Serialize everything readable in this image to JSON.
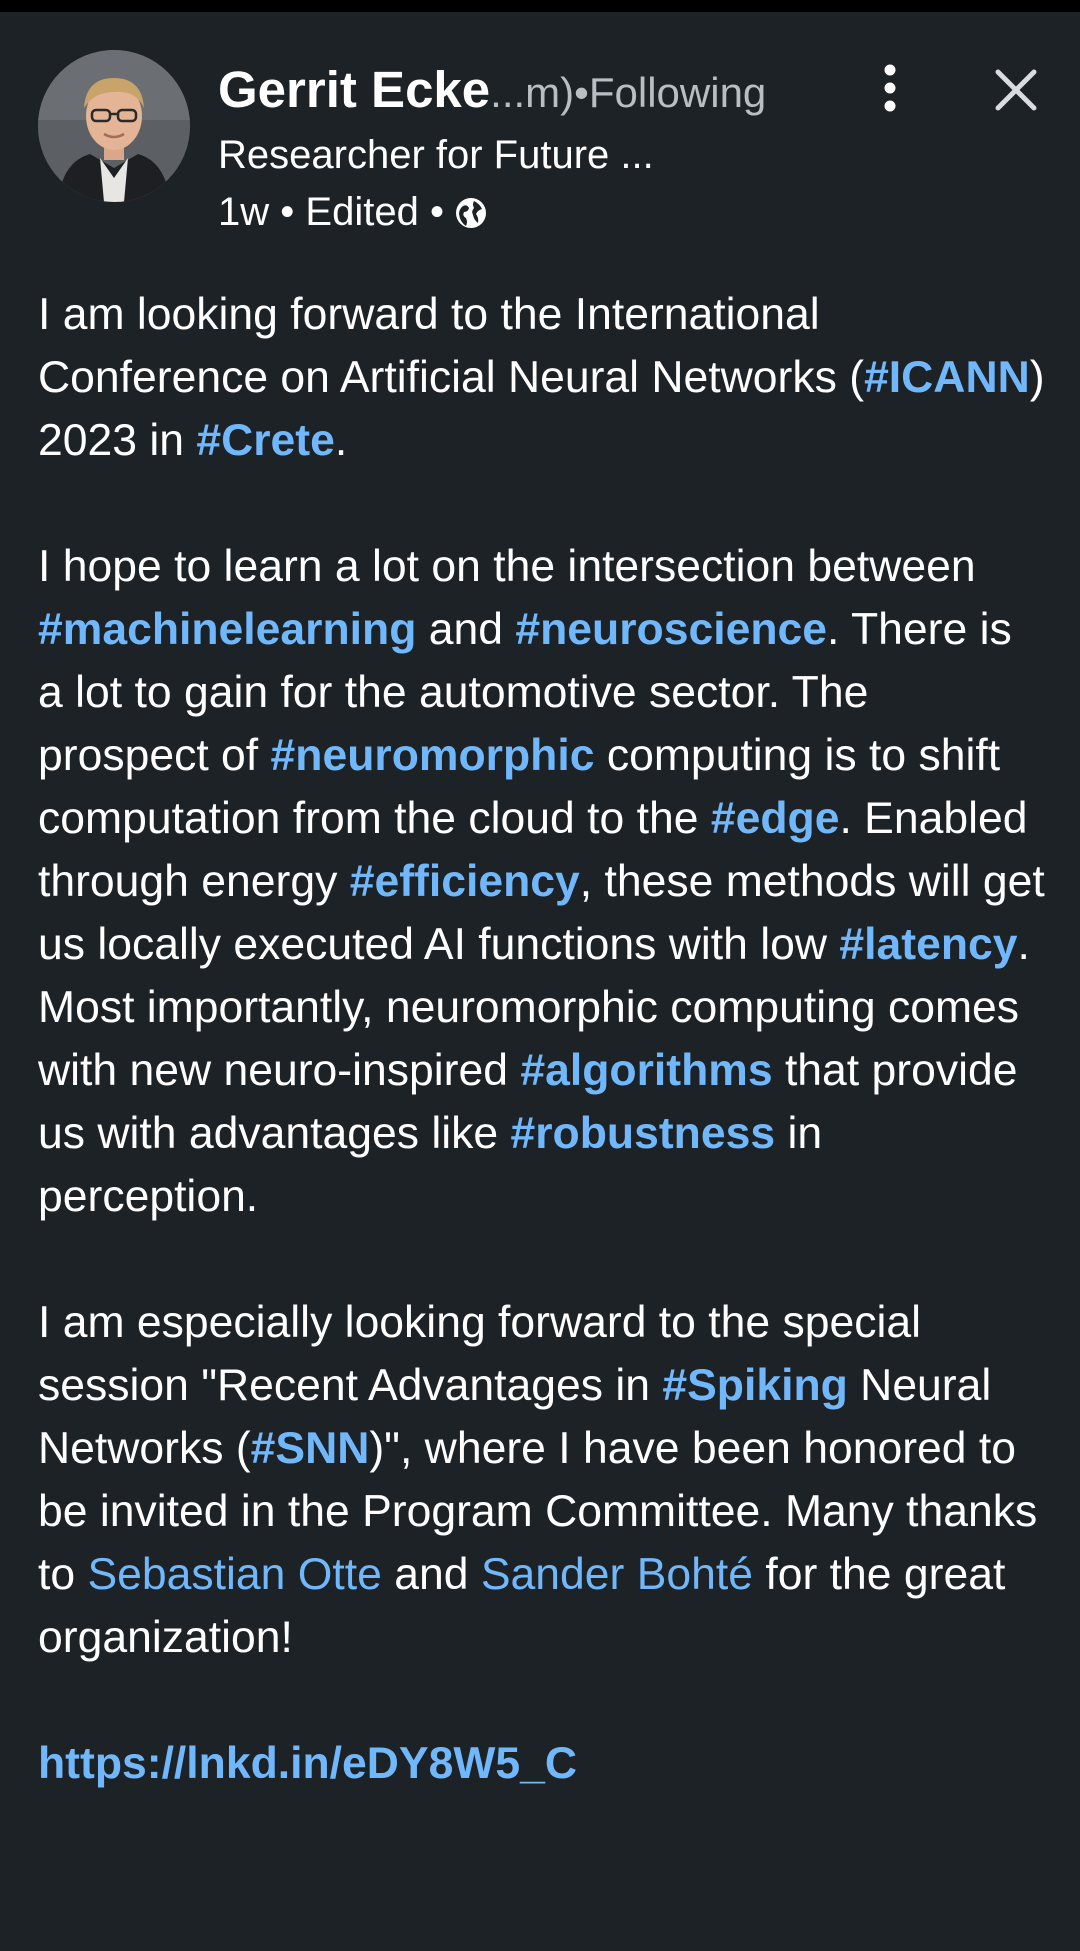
{
  "author": {
    "name": "Gerrit Ecke",
    "name_rest": "...m)",
    "separator": " • ",
    "following": "Following",
    "headline": "Researcher for Future ...",
    "time": "1w",
    "edited": "Edited",
    "dot": "•",
    "visibility_icon": "globe-icon"
  },
  "actions": {
    "more_icon": "kebab-menu-icon",
    "close_icon": "close-icon"
  },
  "post": {
    "p1": [
      {
        "t": "text",
        "v": "I am looking forward to the International Conference on Artificial Neural Networks ("
      },
      {
        "t": "tag",
        "v": "#ICANN"
      },
      {
        "t": "text",
        "v": ") 2023 in "
      },
      {
        "t": "tag",
        "v": "#Crete"
      },
      {
        "t": "text",
        "v": "."
      }
    ],
    "p2": [
      {
        "t": "text",
        "v": "I hope to learn a lot on the intersection between "
      },
      {
        "t": "tag",
        "v": "#machinelearning"
      },
      {
        "t": "text",
        "v": " and "
      },
      {
        "t": "tag",
        "v": "#neuroscience"
      },
      {
        "t": "text",
        "v": ". There is a lot to gain for the automotive sector. The prospect of "
      },
      {
        "t": "tag",
        "v": "#neuromorphic"
      },
      {
        "t": "text",
        "v": " computing is to shift computation from the cloud to the "
      },
      {
        "t": "tag",
        "v": "#edge"
      },
      {
        "t": "text",
        "v": ". Enabled through energy "
      },
      {
        "t": "tag",
        "v": "#efficiency"
      },
      {
        "t": "text",
        "v": ", these methods will get us locally executed AI functions with low "
      },
      {
        "t": "tag",
        "v": "#latency"
      },
      {
        "t": "text",
        "v": ". Most importantly, neuromorphic computing comes with new neuro-inspired "
      },
      {
        "t": "tag",
        "v": "#algorithms"
      },
      {
        "t": "text",
        "v": " that provide us with advantages like "
      },
      {
        "t": "tag",
        "v": "#robustness"
      },
      {
        "t": "text",
        "v": " in perception."
      }
    ],
    "p3": [
      {
        "t": "text",
        "v": "I am especially looking forward to the special session \"Recent Advantages in "
      },
      {
        "t": "tag",
        "v": "#Spiking"
      },
      {
        "t": "text",
        "v": " Neural Networks ("
      },
      {
        "t": "tag",
        "v": "#SNN"
      },
      {
        "t": "text",
        "v": ")\", where I have been honored to be invited in the Program Committee. Many thanks to "
      },
      {
        "t": "mention",
        "v": "Sebastian Otte"
      },
      {
        "t": "text",
        "v": " and "
      },
      {
        "t": "mention",
        "v": "Sander Bohté"
      },
      {
        "t": "text",
        "v": " for the great organization!"
      }
    ],
    "p4": [
      {
        "t": "link",
        "v": "https://lnkd.in/eDY8W5_C"
      }
    ]
  },
  "colors": {
    "background": "#1d2226",
    "link": "#71b7fb",
    "muted": "#b8bec3"
  }
}
